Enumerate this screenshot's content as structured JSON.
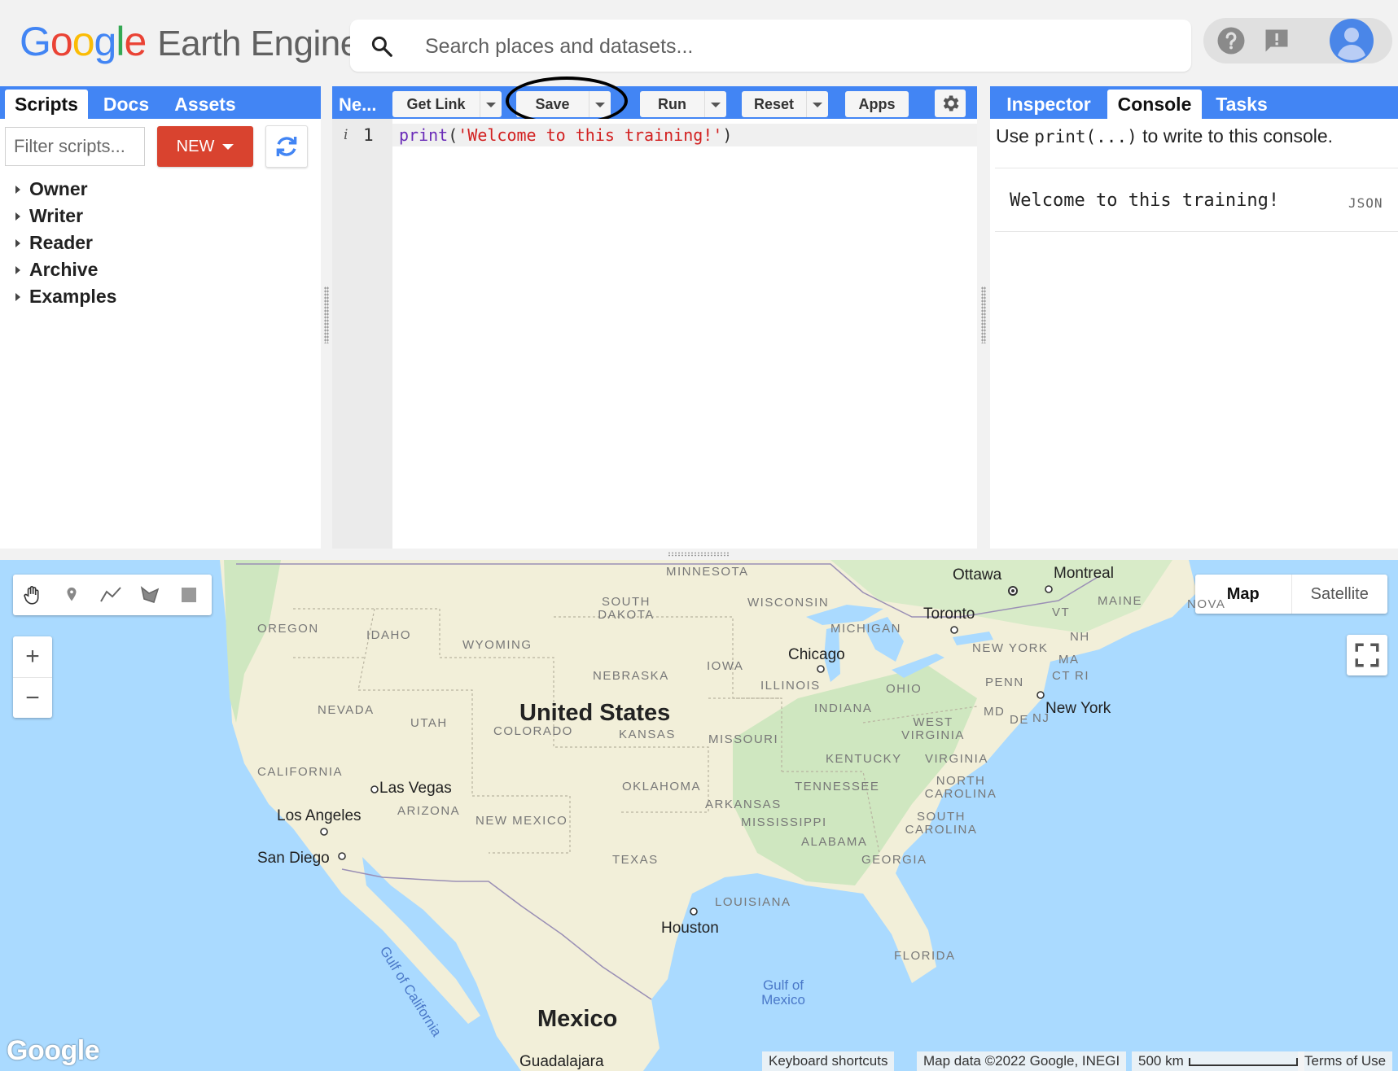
{
  "header": {
    "logo_letters": [
      {
        "ch": "G",
        "color": "#4285f4"
      },
      {
        "ch": "o",
        "color": "#ea4335"
      },
      {
        "ch": "o",
        "color": "#fbbc05"
      },
      {
        "ch": "g",
        "color": "#4285f4"
      },
      {
        "ch": "l",
        "color": "#34a853"
      },
      {
        "ch": "e",
        "color": "#ea4335"
      }
    ],
    "product_name": "Earth Engine",
    "search_placeholder": "Search places and datasets...",
    "icons": [
      "search-icon",
      "help-icon",
      "feedback-icon",
      "avatar"
    ]
  },
  "left_panel": {
    "tabs": [
      {
        "label": "Scripts",
        "active": true
      },
      {
        "label": "Docs",
        "active": false
      },
      {
        "label": "Assets",
        "active": false
      }
    ],
    "filter_placeholder": "Filter scripts...",
    "new_button": "NEW",
    "tree": [
      "Owner",
      "Writer",
      "Reader",
      "Archive",
      "Examples"
    ]
  },
  "editor": {
    "script_name": "Ne...",
    "buttons": {
      "get_link": "Get Link",
      "save": "Save",
      "run": "Run",
      "reset": "Reset",
      "apps": "Apps"
    },
    "gutter_info": "i",
    "line_number": "1",
    "code": {
      "fn": "print",
      "open": "(",
      "string": "'Welcome to this training!'",
      "close": ")"
    }
  },
  "right_panel": {
    "tabs": [
      {
        "label": "Inspector",
        "active": false
      },
      {
        "label": "Console",
        "active": true
      },
      {
        "label": "Tasks",
        "active": false
      }
    ],
    "hint_pre": "Use ",
    "hint_code": "print(...)",
    "hint_post": " to write to this console.",
    "output": "Welcome to this training!",
    "output_type": "JSON"
  },
  "map": {
    "maptype_options": [
      "Map",
      "Satellite"
    ],
    "maptype_selected": "Map",
    "zoom_in": "+",
    "zoom_out": "−",
    "draw_tools": [
      "hand-icon",
      "marker-icon",
      "line-icon",
      "polygon-icon",
      "rectangle-icon"
    ],
    "country_labels": [
      "United States",
      "Mexico"
    ],
    "state_labels": [
      "MINNESOTA",
      "SOUTH DAKOTA",
      "WISCONSIN",
      "MICHIGAN",
      "OREGON",
      "IDAHO",
      "WYOMING",
      "IOWA",
      "NEBRASKA",
      "ILLINOIS",
      "NEVADA",
      "UTAH",
      "COLORADO",
      "KANSAS",
      "MISSOURI",
      "INDIANA",
      "OHIO",
      "PENN",
      "WEST VIRGINIA",
      "VIRGINIA",
      "KENTUCKY",
      "CALIFORNIA",
      "OKLAHOMA",
      "TENNESSEE",
      "NORTH CAROLINA",
      "ARIZONA",
      "NEW MEXICO",
      "ARKANSAS",
      "MISSISSIPPI",
      "SOUTH CAROLINA",
      "ALABAMA",
      "GEORGIA",
      "TEXAS",
      "LOUISIANA",
      "FLORIDA",
      "NEW YORK",
      "MAINE",
      "VT",
      "NH",
      "MA",
      "CT",
      "RI",
      "MD",
      "DE",
      "NJ",
      "NOVA"
    ],
    "city_labels": [
      "Ottawa",
      "Montreal",
      "Toronto",
      "Chicago",
      "New York",
      "Las Vegas",
      "Los Angeles",
      "San Diego",
      "Houston",
      "Guadalajara"
    ],
    "water_labels": [
      "Gulf of California",
      "Gulf of Mexico"
    ],
    "watermark": "Google",
    "footer": {
      "shortcuts": "Keyboard shortcuts",
      "attribution": "Map data ©2022 Google, INEGI",
      "scale": "500 km",
      "terms": "Terms of Use"
    },
    "colors": {
      "water": "#aadaff",
      "land": "#f2efd9",
      "green": "#cfe7c0"
    }
  }
}
